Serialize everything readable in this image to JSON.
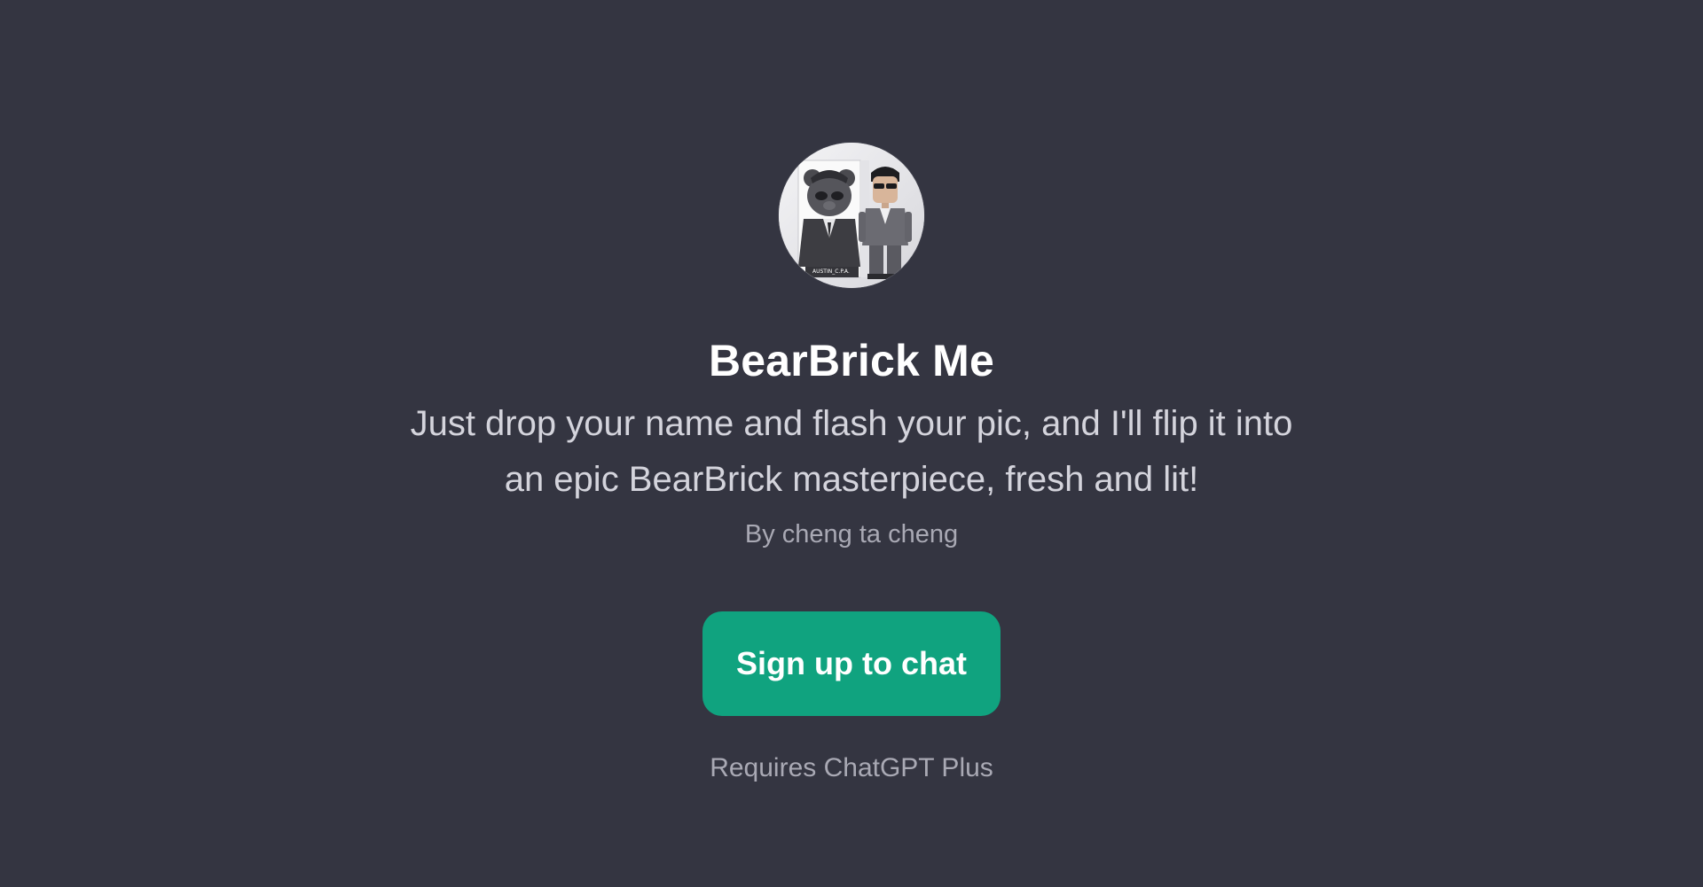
{
  "gpt": {
    "name": "BearBrick Me",
    "description": "Just drop your name and flash your pic, and I'll flip it into an epic BearBrick masterpiece, fresh and lit!",
    "author": "By cheng ta cheng",
    "avatar_icon": "bearbrick-figures-avatar",
    "avatar_box_text": "AUSTIN_C.P.A."
  },
  "actions": {
    "signup_label": "Sign up to chat",
    "requirement": "Requires ChatGPT Plus"
  },
  "colors": {
    "background": "#343541",
    "accent": "#10a37f",
    "title": "#ffffff",
    "description": "#d4d4dc",
    "muted": "#a9a9b4"
  }
}
